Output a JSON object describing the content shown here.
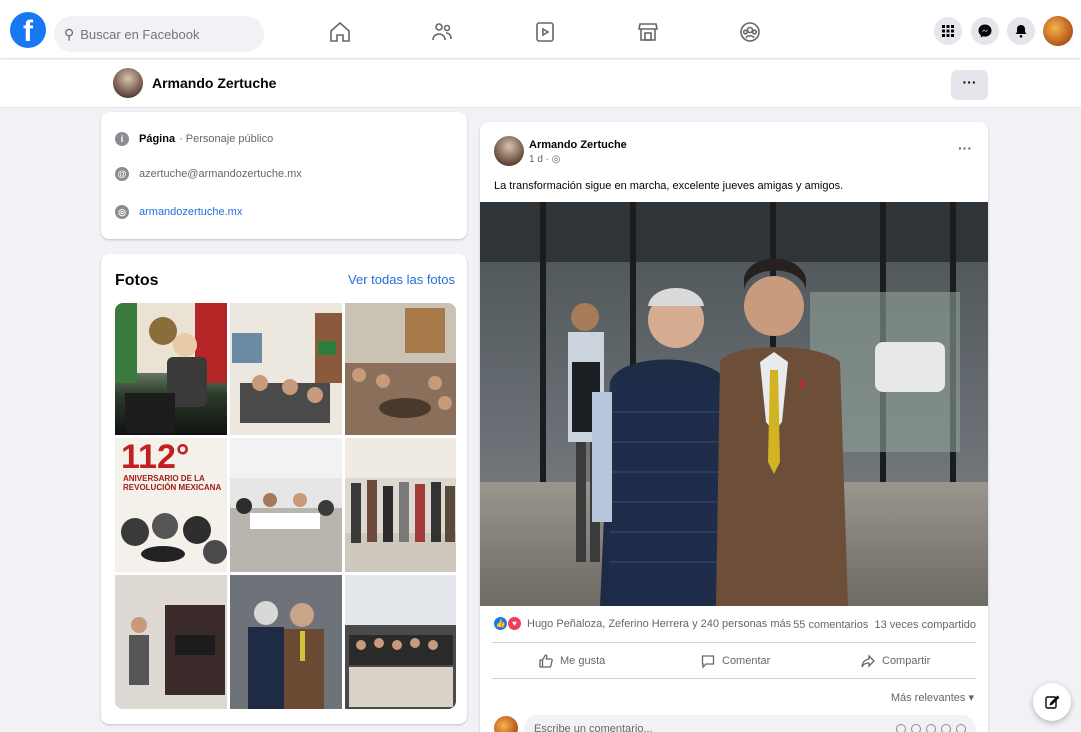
{
  "topbar": {
    "logo": "f",
    "search_placeholder": "Buscar en Facebook",
    "nav_icons": [
      "home-icon",
      "friends-icon",
      "watch-icon",
      "marketplace-icon",
      "groups-icon"
    ],
    "right_icons": [
      "menu-grid-icon",
      "messenger-icon",
      "notifications-icon"
    ]
  },
  "profile": {
    "name": "Armando Zertuche",
    "more_label": "···"
  },
  "intro": {
    "page_label": "Página",
    "page_category": "· Personaje público",
    "email": "azertuche@armandozertuche.mx",
    "website": "armandozertuche.mx"
  },
  "photos": {
    "title": "Fotos",
    "see_all": "Ver todas las fotos",
    "poster_number": "112°",
    "poster_text": "ANIVERSARIO DE LA REVOLUCIÓN MEXICANA"
  },
  "post": {
    "author": "Armando Zertuche",
    "time": "1 d · ",
    "more_label": "···",
    "text": "La transformación sigue en marcha, excelente jueves amigas y amigos.",
    "reactions_text": "Hugo Peñaloza, Zeferino Herrera y 240 personas más",
    "comments_count": "55 comentarios",
    "shares_count": "13 veces compartido",
    "like_label": "Me gusta",
    "comment_label": "Comentar",
    "share_label": "Compartir",
    "relevance_label": "Más relevantes ▾",
    "comment_placeholder": "Escribe un comentario..."
  },
  "colors": {
    "brand": "#1877f2",
    "link": "#216fdb",
    "background": "#f0f2f5"
  }
}
